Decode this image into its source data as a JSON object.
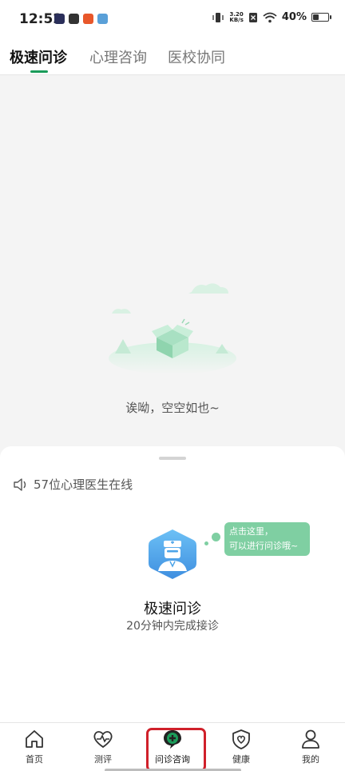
{
  "status_bar": {
    "time": "12:52",
    "net_speed_value": "3.20",
    "net_speed_unit": "KB/s",
    "battery": "40%",
    "battery_level": 0.4
  },
  "tabs": [
    {
      "label": "极速问诊",
      "active": true
    },
    {
      "label": "心理咨询",
      "active": false
    },
    {
      "label": "医校协同",
      "active": false
    }
  ],
  "empty_state": {
    "message": "诶呦，空空如也~"
  },
  "sheet": {
    "online_text": "57位心理医生在线",
    "bubble_line1": "点击这里，",
    "bubble_line2": "可以进行问诊哦~",
    "title": "极速问诊",
    "subtitle": "20分钟内完成接诊"
  },
  "bottom_nav": [
    {
      "label": "首页",
      "icon": "home-icon"
    },
    {
      "label": "测评",
      "icon": "heart-pulse-icon"
    },
    {
      "label": "问诊咨询",
      "icon": "consult-chat-icon",
      "active": true
    },
    {
      "label": "健康",
      "icon": "shield-heart-icon"
    },
    {
      "label": "我的",
      "icon": "person-icon"
    }
  ],
  "colors": {
    "accent_green": "#1a9c5a",
    "bubble_green": "#7fcfa2",
    "badge_blue": "#4aa3e8",
    "highlight_red": "#d0202a"
  }
}
